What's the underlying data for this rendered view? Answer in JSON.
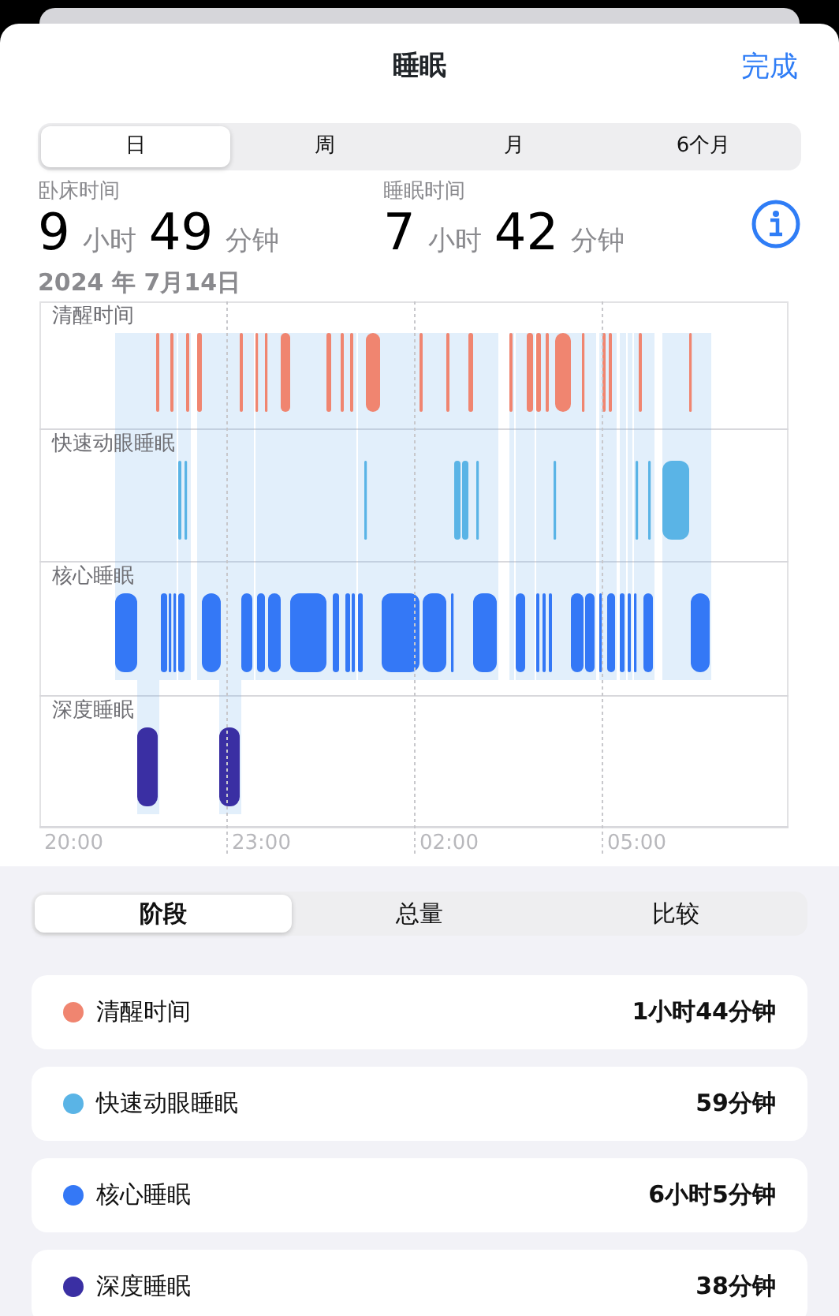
{
  "header": {
    "title": "睡眠",
    "done": "完成"
  },
  "range_tabs": [
    {
      "label": "日",
      "selected": true
    },
    {
      "label": "周",
      "selected": false
    },
    {
      "label": "月",
      "selected": false
    },
    {
      "label": "6个月",
      "selected": false
    }
  ],
  "summary": [
    {
      "label": "卧床时间",
      "hours": "9",
      "hours_unit": "小时",
      "minutes": "49",
      "minutes_unit": "分钟"
    },
    {
      "label": "睡眠时间",
      "hours": "7",
      "hours_unit": "小时",
      "minutes": "42",
      "minutes_unit": "分钟"
    }
  ],
  "date": "2024 年 7月14日",
  "chart": {
    "stages": [
      {
        "label": "清醒时间",
        "kind": "awake"
      },
      {
        "label": "快速动眼睡眠",
        "kind": "rem"
      },
      {
        "label": "核心睡眠",
        "kind": "core"
      },
      {
        "label": "深度睡眠",
        "kind": "deep"
      }
    ],
    "time_labels": [
      "20:00",
      "23:00",
      "02:00",
      "05:00"
    ]
  },
  "view_tabs": [
    {
      "label": "阶段",
      "selected": true
    },
    {
      "label": "总量",
      "selected": false
    },
    {
      "label": "比较",
      "selected": false
    }
  ],
  "legend": [
    {
      "label": "清醒时间",
      "value": "1小时44分钟",
      "color": "#f08570"
    },
    {
      "label": "快速动眼睡眠",
      "value": "59分钟",
      "color": "#5ab4e6"
    },
    {
      "label": "核心睡眠",
      "value": "6小时5分钟",
      "color": "#3478f6"
    },
    {
      "label": "深度睡眠",
      "value": "38分钟",
      "color": "#3a2fa3"
    }
  ]
}
